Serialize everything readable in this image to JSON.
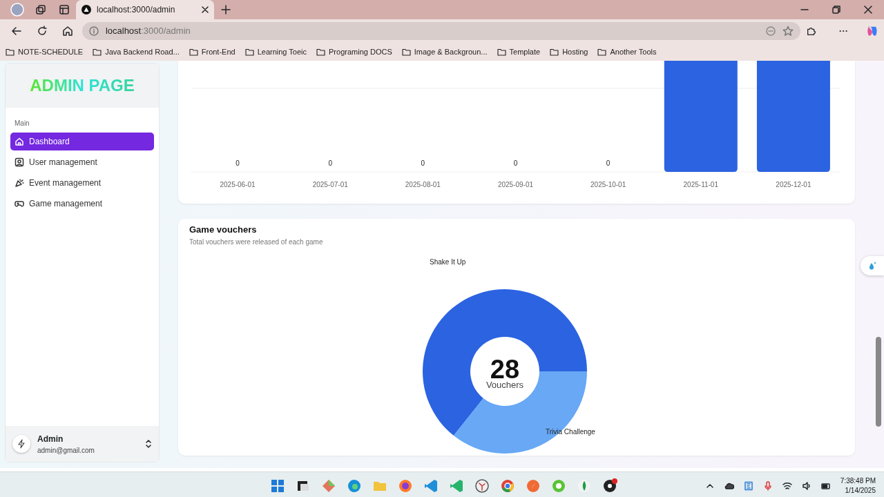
{
  "browser": {
    "tab_title": "localhost:3000/admin",
    "address_host": "localhost",
    "address_rest": ":3000/admin",
    "bookmarks": [
      "NOTE-SCHEDULE",
      "Java Backend Road...",
      "Front-End",
      "Learning Toeic",
      "Programing DOCS",
      "Image & Backgroun...",
      "Template",
      "Hosting",
      "Another Tools"
    ]
  },
  "sidebar": {
    "logo": "ADMIN PAGE",
    "section_label": "Main",
    "items": [
      {
        "label": "Dashboard",
        "selected": true
      },
      {
        "label": "User management",
        "selected": false
      },
      {
        "label": "Event management",
        "selected": false
      },
      {
        "label": "Game management",
        "selected": false
      }
    ],
    "user": {
      "name": "Admin",
      "email": "admin@gmail.com"
    }
  },
  "monthly_chart": {
    "bars": [
      {
        "category": "2025-06-01",
        "kind": "zero",
        "value_label": "0"
      },
      {
        "category": "2025-07-01",
        "kind": "zero",
        "value_label": "0"
      },
      {
        "category": "2025-08-01",
        "kind": "zero",
        "value_label": "0"
      },
      {
        "category": "2025-09-01",
        "kind": "zero",
        "value_label": "0"
      },
      {
        "category": "2025-10-01",
        "kind": "zero",
        "value_label": "0"
      },
      {
        "category": "2025-11-01",
        "kind": "tall"
      },
      {
        "category": "2025-12-01",
        "kind": "tall"
      }
    ]
  },
  "vouchers": {
    "title": "Game vouchers",
    "subtitle": "Total vouchers were released of each game",
    "center_value": "28",
    "center_label": "Vouchers",
    "chart_data": {
      "type": "donut",
      "categories": [
        "Shake It Up",
        "Trivia Challenge"
      ],
      "values": [
        64.3,
        35.7
      ],
      "colors": [
        "#2b63e1",
        "#68a8f5"
      ]
    }
  },
  "taskbar": {
    "time": "7:38:48 PM",
    "date": "1/14/2025"
  }
}
